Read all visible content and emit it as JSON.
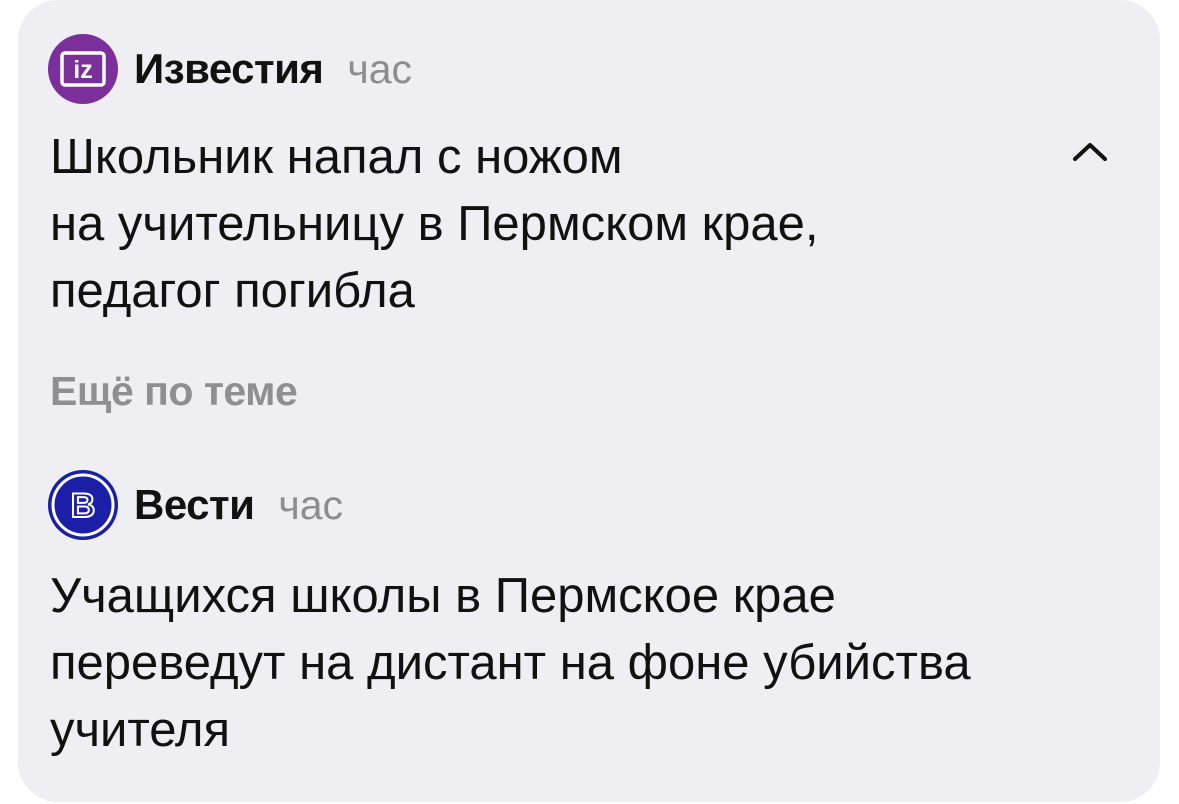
{
  "items": [
    {
      "source": "Известия",
      "time": "час",
      "logo_text": "iz",
      "headline": "Школьник напал с ножом\nна учительницу в Пермском крае,\nпедагог погибла"
    },
    {
      "source": "Вести",
      "time": "час",
      "logo_text": "В",
      "headline": "Учащихся школы в Пермское крае\nпереведут на дистант на фоне убийства\nучителя"
    }
  ],
  "more_on_topic": "Ещё по теме",
  "colors": {
    "card_bg": "#efeef3",
    "izvestia_logo": "#7a2f9b",
    "vesti_logo": "#1b1fa8",
    "muted_text": "#8e8e93"
  },
  "icons": {
    "collapse": "chevron-up-icon"
  }
}
